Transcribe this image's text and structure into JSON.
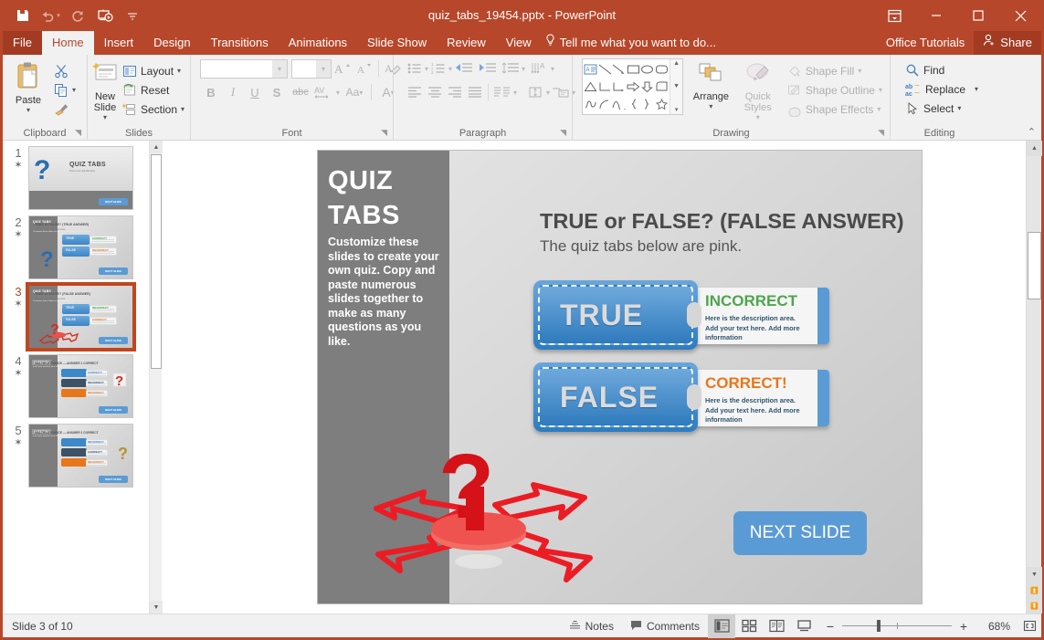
{
  "titlebar": {
    "document_title": "quiz_tabs_19454.pptx - PowerPoint",
    "qat": [
      {
        "name": "save-icon",
        "label": "Save"
      },
      {
        "name": "undo-icon",
        "label": "Undo"
      },
      {
        "name": "redo-icon",
        "label": "Repeat"
      },
      {
        "name": "start-presentation-icon",
        "label": "Start From Beginning"
      },
      {
        "name": "customize-qat-icon",
        "label": "Customize Quick Access Toolbar"
      }
    ],
    "window": [
      {
        "name": "ribbon-display-options-icon",
        "label": "Ribbon Display Options"
      },
      {
        "name": "minimize-icon",
        "label": "Minimize"
      },
      {
        "name": "restore-icon",
        "label": "Restore Down"
      },
      {
        "name": "close-icon",
        "label": "Close"
      }
    ]
  },
  "tabs": {
    "file": "File",
    "items": [
      "Home",
      "Insert",
      "Design",
      "Transitions",
      "Animations",
      "Slide Show",
      "Review",
      "View"
    ],
    "active": "Home",
    "tell_me": "Tell me what you want to do...",
    "office_tutorials": "Office Tutorials",
    "share": "Share"
  },
  "ribbon": {
    "groups": [
      {
        "label": "Clipboard",
        "items": [
          {
            "label": "Paste",
            "name": "paste-button"
          },
          {
            "label": "Cut",
            "name": "cut-button"
          },
          {
            "label": "Copy",
            "name": "copy-button"
          },
          {
            "label": "Format Painter",
            "name": "format-painter-button"
          }
        ]
      },
      {
        "label": "Slides",
        "items": [
          {
            "label": "New Slide",
            "name": "new-slide-button"
          },
          {
            "label": "Layout",
            "name": "layout-button"
          },
          {
            "label": "Reset",
            "name": "reset-button"
          },
          {
            "label": "Section",
            "name": "section-button"
          }
        ]
      },
      {
        "label": "Font",
        "font_name": "",
        "font_size": "",
        "items": [
          {
            "label": "Increase Font Size",
            "name": "increase-font-size-button"
          },
          {
            "label": "Decrease Font Size",
            "name": "decrease-font-size-button"
          },
          {
            "label": "Clear All Formatting",
            "name": "clear-formatting-button"
          },
          {
            "label": "B",
            "name": "bold-button"
          },
          {
            "label": "I",
            "name": "italic-button"
          },
          {
            "label": "U",
            "name": "underline-button"
          },
          {
            "label": "S",
            "name": "text-shadow-button"
          },
          {
            "label": "abc",
            "name": "strikethrough-button"
          },
          {
            "label": "AV",
            "name": "character-spacing-button"
          },
          {
            "label": "Aa",
            "name": "change-case-button"
          },
          {
            "label": "A",
            "name": "font-color-button"
          }
        ]
      },
      {
        "label": "Paragraph",
        "items": [
          {
            "label": "Bullets",
            "name": "bullets-button"
          },
          {
            "label": "Numbering",
            "name": "numbering-button"
          },
          {
            "label": "Decrease List Level",
            "name": "decrease-indent-button"
          },
          {
            "label": "Increase List Level",
            "name": "increase-indent-button"
          },
          {
            "label": "Line Spacing",
            "name": "line-spacing-button"
          },
          {
            "label": "Text Direction",
            "name": "text-direction-button"
          },
          {
            "label": "Align Text",
            "name": "align-text-button"
          },
          {
            "label": "Convert to SmartArt",
            "name": "smartart-button"
          },
          {
            "label": "Align Left",
            "name": "align-left-button"
          },
          {
            "label": "Center",
            "name": "align-center-button"
          },
          {
            "label": "Align Right",
            "name": "align-right-button"
          },
          {
            "label": "Justify",
            "name": "justify-button"
          },
          {
            "label": "Columns",
            "name": "columns-button"
          }
        ]
      },
      {
        "label": "Drawing",
        "arrange": "Arrange",
        "quick_styles": "Quick Styles",
        "shape_fill": "Shape Fill",
        "shape_outline": "Shape Outline",
        "shape_effects": "Shape Effects"
      },
      {
        "label": "Editing",
        "find": "Find",
        "replace": "Replace",
        "select": "Select"
      }
    ],
    "collapse_label": "Collapse the Ribbon"
  },
  "thumbnails": [
    {
      "number": "1",
      "star": "✶",
      "kind": "title",
      "title": "QUIZ TABS",
      "subtitle": "Insert your sub-title here",
      "next": "NEXT SLIDE"
    },
    {
      "number": "2",
      "star": "✶",
      "kind": "tf",
      "side_title": "QUIZ TABS",
      "heading": "TRUE or FALSE? (TRUE ANSWER)",
      "sub": "The quiz tabs below are blue.",
      "rows": [
        {
          "label": "TRUE",
          "answer": "CORRECT!",
          "color": "#4ca64c"
        },
        {
          "label": "FALSE",
          "answer": "INCORRECT",
          "color": "#e8761a"
        }
      ],
      "next": "NEXT SLIDE",
      "qcolor": "#2b6cb0"
    },
    {
      "number": "3",
      "star": "✶",
      "kind": "tf",
      "side_title": "QUIZ TABS",
      "heading": "TRUE or FALSE? (FALSE ANSWER)",
      "sub": "The quiz tabs below are pink.",
      "rows": [
        {
          "label": "TRUE",
          "answer": "INCORRECT",
          "color": "#4ca64c"
        },
        {
          "label": "FALSE",
          "answer": "CORRECT!",
          "color": "#e8761a"
        }
      ],
      "next": "NEXT SLIDE",
      "qcolor": "#d52b1e",
      "selected": true
    },
    {
      "number": "4",
      "star": "✶",
      "kind": "mc",
      "side_title": "QUESTION",
      "heading": "MULTIPLE CHOICE — ANSWER 1 CORRECT",
      "rows": [
        {
          "answer": "CORRECT!",
          "bg": "#3c88c8"
        },
        {
          "answer": "INCORRECT",
          "bg": "#3d5266"
        },
        {
          "answer": "INCORRECT",
          "bg": "#e8761a"
        }
      ],
      "next": "NEXT SLIDE",
      "qcolor": "#d52b1e"
    },
    {
      "number": "5",
      "star": "✶",
      "kind": "mc",
      "side_title": "QUESTION",
      "heading": "MULTIPLE CHOICE — ANSWER 2 CORRECT",
      "rows": [
        {
          "answer": "INCORRECT",
          "bg": "#3c88c8"
        },
        {
          "answer": "CORRECT!",
          "bg": "#3d5266"
        },
        {
          "answer": "INCORRECT",
          "bg": "#e8761a"
        }
      ],
      "next": "NEXT SLIDE",
      "qcolor": "#b8912b"
    }
  ],
  "slide": {
    "sidebar_title_line1": "QUIZ",
    "sidebar_title_line2": "TABS",
    "sidebar_body": "Customize these slides to create your own quiz. Copy and paste numerous slides together to make as many questions as you like.",
    "heading": "TRUE or FALSE? (FALSE ANSWER)",
    "subheading": "The quiz tabs below are pink.",
    "tabs": [
      {
        "label": "TRUE",
        "answer": "INCORRECT",
        "answer_color": "#4ca64c",
        "description": "Here is the description area. Add your text here.  Add more information"
      },
      {
        "label": "FALSE",
        "answer": "CORRECT!",
        "answer_color": "#e8761a",
        "description": "Here is the description area. Add your text here.  Add more information"
      }
    ],
    "next_button": "NEXT SLIDE"
  },
  "statusbar": {
    "slide_indicator": "Slide 3 of 10",
    "notes": "Notes",
    "comments": "Comments",
    "views": [
      {
        "name": "normal-view-button",
        "label": "Normal",
        "active": true
      },
      {
        "name": "slide-sorter-view-button",
        "label": "Slide Sorter",
        "active": false
      },
      {
        "name": "reading-view-button",
        "label": "Reading View",
        "active": false
      },
      {
        "name": "slide-show-button",
        "label": "Slide Show",
        "active": false
      }
    ],
    "zoom_out": "−",
    "zoom_in": "+",
    "zoom_value": "68%",
    "fit_label": "Fit slide to current window"
  },
  "colors": {
    "brand": "#b7472a",
    "accent_blue": "#5b9bd5",
    "correct": "#e8761a",
    "incorrect": "#4ca64c"
  }
}
